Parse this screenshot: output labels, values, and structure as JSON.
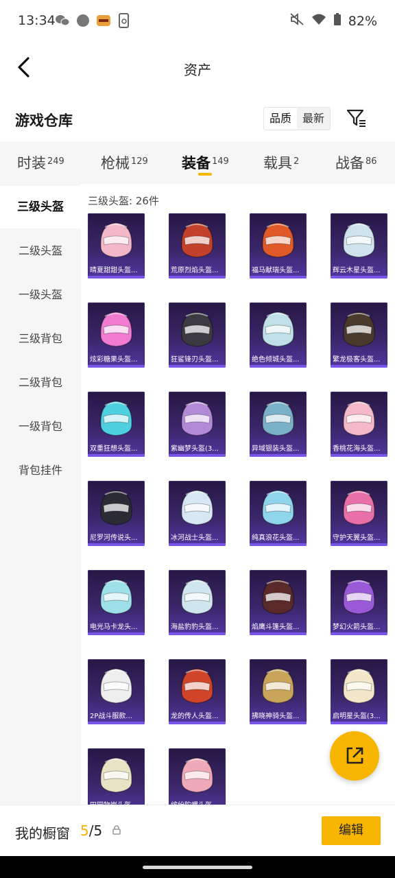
{
  "status_bar": {
    "time": "13:34",
    "battery": "82%",
    "icons": [
      "wechat-icon",
      "notification-dot-icon",
      "app-badge-icon",
      "phone-clean-icon",
      "mute-icon",
      "wifi-icon",
      "battery-icon"
    ]
  },
  "header": {
    "title": "资产",
    "back_icon": "chevron-left-icon"
  },
  "section": {
    "title": "游戏仓库",
    "sort_options": [
      "品质",
      "最新"
    ],
    "filter_icon": "filter-icon"
  },
  "tabs": [
    {
      "label": "时装",
      "count": "249"
    },
    {
      "label": "枪械",
      "count": "129"
    },
    {
      "label": "装备",
      "count": "149",
      "active": true
    },
    {
      "label": "载具",
      "count": "2"
    },
    {
      "label": "战备",
      "count": "86"
    }
  ],
  "sidebar": {
    "items": [
      "三级头盔",
      "二级头盔",
      "一级头盔",
      "三级背包",
      "二级背包",
      "一级背包",
      "背包挂件"
    ],
    "active_index": 0
  },
  "content": {
    "category_count": "三级头盔: 26件",
    "items": [
      {
        "name": "晴夏甜甜头盔...",
        "color": "#f2b7c9"
      },
      {
        "name": "荒原烈焰头盔...",
        "color": "#c2412a"
      },
      {
        "name": "福马献瑞头盔...",
        "color": "#e05a28"
      },
      {
        "name": "辉云木星头盔...",
        "color": "#cfe3ee"
      },
      {
        "name": "炫彩糖果头盔...",
        "color": "#f07bd0"
      },
      {
        "name": "狂鲨锋刃头盔...",
        "color": "#3a3a40"
      },
      {
        "name": "绝色倾城头盔...",
        "color": "#bfe0e8"
      },
      {
        "name": "繁龙极客头盔...",
        "color": "#4a3a2e"
      },
      {
        "name": "双重狂想头盔...",
        "color": "#4fd0e0"
      },
      {
        "name": "紫幽梦头盔(3...",
        "color": "#b38ad8"
      },
      {
        "name": "异域银装头盔...",
        "color": "#7ab0c8"
      },
      {
        "name": "香桃花海头盔...",
        "color": "#f3b9c8"
      },
      {
        "name": "尼罗河传说头...",
        "color": "#2b2b36"
      },
      {
        "name": "冰河战士头盔...",
        "color": "#d7e7f4"
      },
      {
        "name": "纯真浪花头盔...",
        "color": "#8fd6ec"
      },
      {
        "name": "守护天翼头盔...",
        "color": "#e86fa8"
      },
      {
        "name": "电光马卡龙头...",
        "color": "#9ee0e8"
      },
      {
        "name": "海盐豹豹头盔...",
        "color": "#cfe6ee"
      },
      {
        "name": "焰鹰斗篷头盔...",
        "color": "#5a2a2a"
      },
      {
        "name": "梦幻火箭头盔...",
        "color": "#9a5ad8"
      },
      {
        "name": "2P战斗服款...",
        "color": "#eeeeee"
      },
      {
        "name": "龙的传人头盔...",
        "color": "#d0452a"
      },
      {
        "name": "拂晓神骑头盔...",
        "color": "#c9a55a"
      },
      {
        "name": "启明星头盔(3...",
        "color": "#f4e6c8"
      },
      {
        "name": "田园物岸头盔...",
        "color": "#e8e3c4"
      },
      {
        "name": "缤纷陀螺头盔...",
        "color": "#f0a9b8"
      }
    ]
  },
  "share_icon": "share-external-icon",
  "bottom_bar": {
    "label": "我的橱窗",
    "used": "5",
    "total": "5",
    "lock_icon": "lock-icon",
    "edit_label": "编辑"
  },
  "colors": {
    "accent": "#f7b500",
    "card_bg": "#3a2668"
  }
}
